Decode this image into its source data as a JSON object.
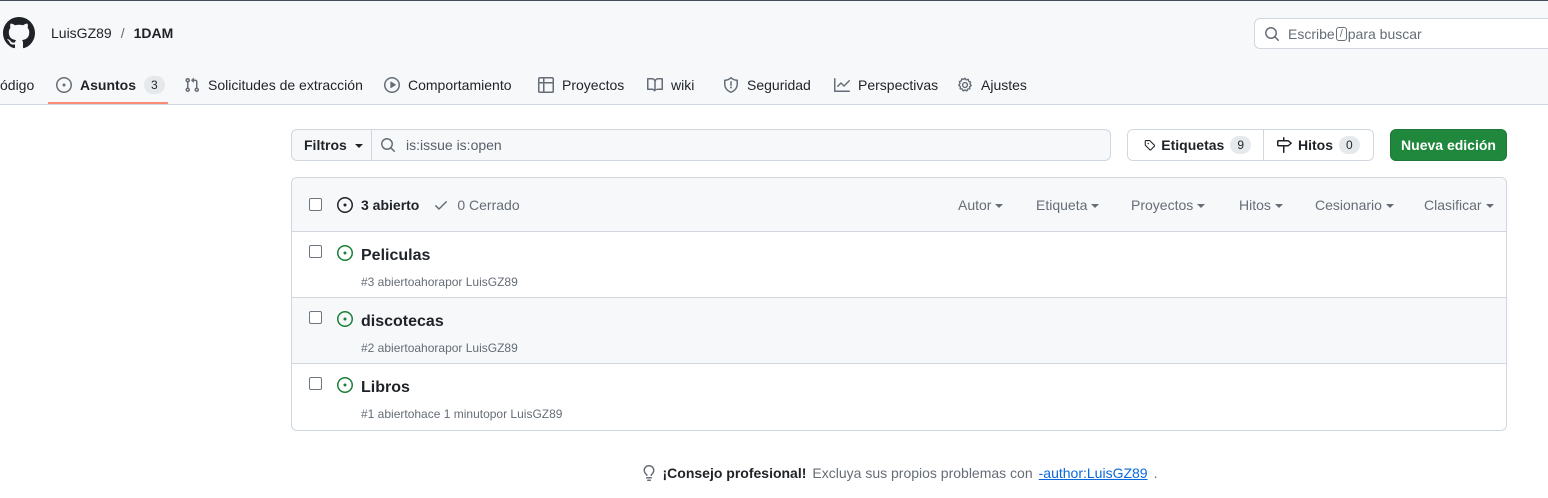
{
  "header": {
    "owner": "LuisGZ89",
    "separator": "/",
    "repo": "1DAM",
    "search_prefix": "Escribe",
    "search_key": "/",
    "search_suffix": "para buscar"
  },
  "nav": {
    "code": "ódigo",
    "issues": "Asuntos",
    "issues_count": "3",
    "pulls": "Solicitudes de extracción",
    "actions": "Comportamiento",
    "projects": "Proyectos",
    "wiki": "wiki",
    "security": "Seguridad",
    "insights": "Perspectivas",
    "settings": "Ajustes"
  },
  "toolbar": {
    "filters": "Filtros",
    "query": "is:issue is:open",
    "labels": "Etiquetas",
    "labels_count": "9",
    "milestones": "Hitos",
    "milestones_count": "0",
    "new_issue": "Nueva edición"
  },
  "issues_header": {
    "open": "3 abierto",
    "closed": "0 Cerrado",
    "author": "Autor",
    "label": "Etiqueta",
    "projects": "Proyectos",
    "milestones": "Hitos",
    "assignee": "Cesionario",
    "sort": "Clasificar"
  },
  "issues": [
    {
      "title": "Peliculas",
      "meta": "#3 abiertoahorapor LuisGZ89"
    },
    {
      "title": "discotecas",
      "meta": "#2 abiertoahorapor LuisGZ89"
    },
    {
      "title": "Libros",
      "meta": "#1 abiertohace 1 minutopor LuisGZ89"
    }
  ],
  "protip": {
    "label": "¡Consejo profesional!",
    "text": "Excluya sus propios problemas con",
    "link": "-author:LuisGZ89",
    "end": "."
  },
  "colors": {
    "accent_green": "#1f883d",
    "open_issue_icon": "#1a7f37",
    "link_blue": "#0969da",
    "nav_underline": "#fd8c73"
  }
}
